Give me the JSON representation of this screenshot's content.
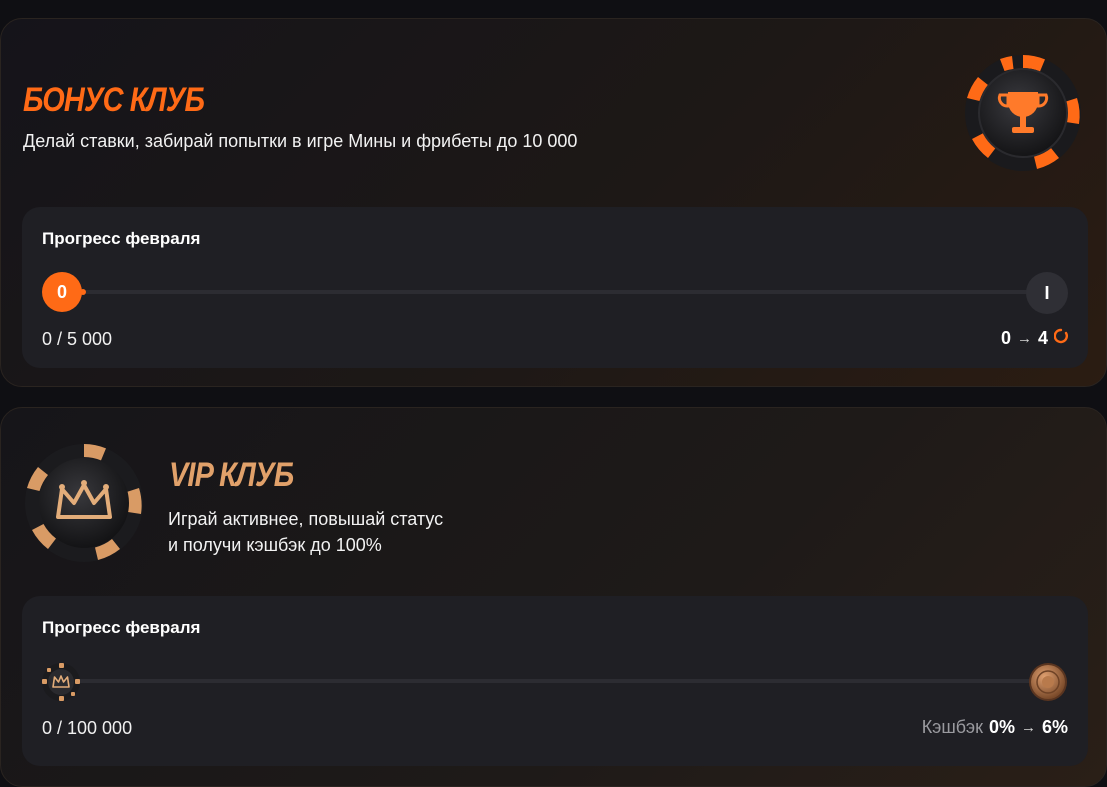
{
  "bonus_club": {
    "title": "БОНУС КЛУБ",
    "description": "Делай ставки, забирай попытки в игре Мины и фрибеты до 10 000",
    "progress": {
      "title": "Прогресс февраля",
      "start_level": "0",
      "end_level": "I",
      "progress_text": "0 / 5 000",
      "attempts_from": "0",
      "arrow": "→",
      "attempts_to": "4",
      "fill_fraction": 0
    },
    "icon": "trophy-chip-icon"
  },
  "vip_club": {
    "title": "VIP КЛУБ",
    "description_line1": "Играй активнее, повышай статус",
    "description_line2": "и получи кэшбэк до 100%",
    "progress": {
      "title": "Прогресс февраля",
      "progress_text": "0 / 100 000",
      "cashback_label": "Кэшбэк",
      "cashback_from": "0%",
      "arrow": "→",
      "cashback_to": "6%",
      "fill_fraction": 0
    },
    "icon": "crown-chip-icon"
  },
  "colors": {
    "accent_orange": "#ff6a16",
    "vip_gold": "#e1a16a",
    "panel_bg": "#1f1f24",
    "page_bg": "#0f0f13"
  }
}
